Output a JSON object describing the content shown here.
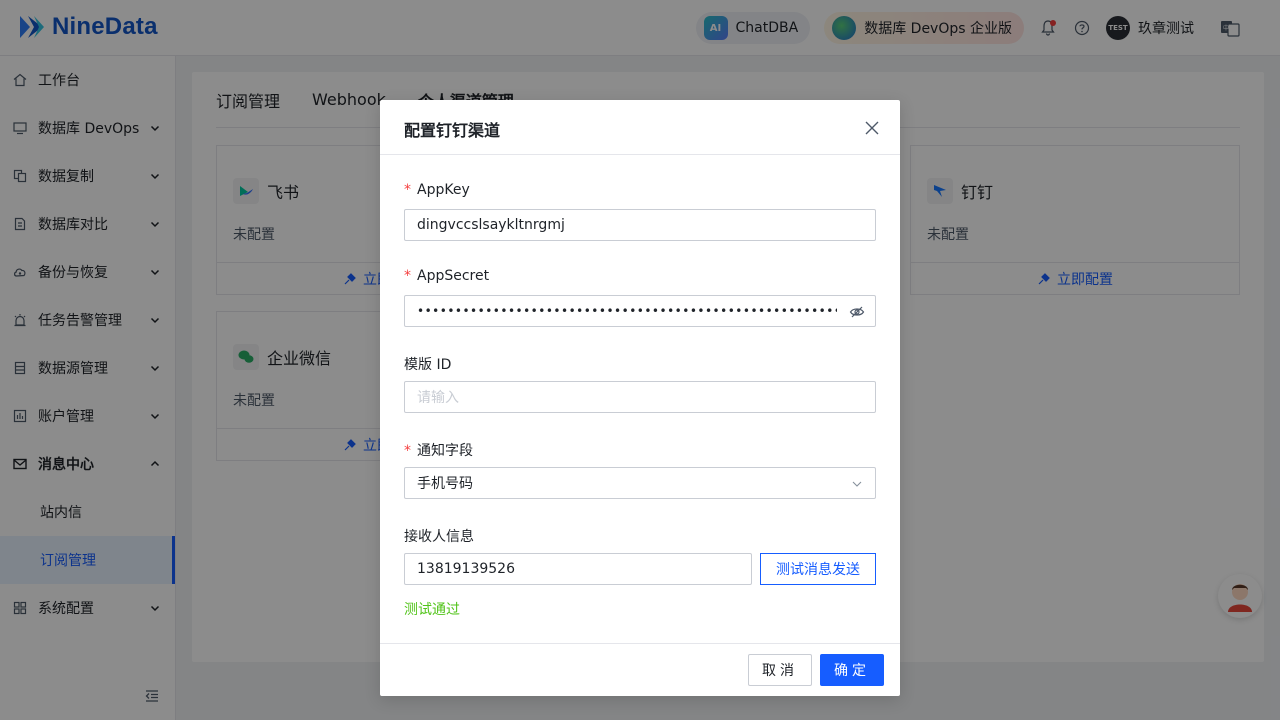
{
  "header": {
    "logo_text": "NineData",
    "chat_label": "ChatDBA",
    "ai_badge": "AI",
    "devops_label": "数据库 DevOps 企业版",
    "user_avatar_text": "TEST",
    "user_name": "玖章测试"
  },
  "sidebar": {
    "items": [
      {
        "label": "工作台"
      },
      {
        "label": "数据库 DevOps"
      },
      {
        "label": "数据复制"
      },
      {
        "label": "数据库对比"
      },
      {
        "label": "备份与恢复"
      },
      {
        "label": "任务告警管理"
      },
      {
        "label": "数据源管理"
      },
      {
        "label": "账户管理"
      },
      {
        "label": "消息中心"
      },
      {
        "label": "系统配置"
      }
    ],
    "sub_items": [
      {
        "label": "站内信"
      },
      {
        "label": "订阅管理"
      }
    ]
  },
  "main": {
    "tabs": [
      {
        "label": "订阅管理"
      },
      {
        "label": "Webhook"
      },
      {
        "label": "个人渠道管理"
      }
    ],
    "cards": [
      {
        "name": "飞书",
        "status": "未配置",
        "action": "立即配置"
      },
      {
        "name": "钉钉",
        "status": "未配置",
        "action": "立即配置"
      },
      {
        "name": "企业微信",
        "status": "未配置",
        "action": "立即配置"
      }
    ]
  },
  "modal": {
    "title": "配置钉钉渠道",
    "appkey_label": "AppKey",
    "appkey_value": "dingvccslsaykltnrgmj",
    "appsecret_label": "AppSecret",
    "appsecret_value": "•••••••••••••••••••••••••••••••••••••••••••••••••••••••••••••••••",
    "template_label": "模版 ID",
    "template_placeholder": "请输入",
    "notify_label": "通知字段",
    "notify_value": "手机号码",
    "receiver_label": "接收人信息",
    "receiver_value": "13819139526",
    "test_button": "测试消息发送",
    "test_result": "测试通过",
    "cancel": "取消",
    "ok": "确定",
    "required_mark": "*"
  },
  "colors": {
    "primary": "#165dff",
    "success": "#52c41a",
    "required": "#f53f3f"
  }
}
